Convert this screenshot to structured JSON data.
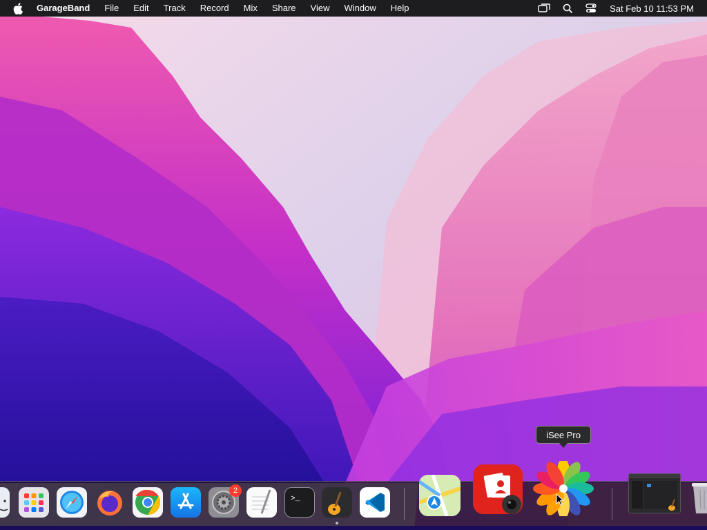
{
  "menubar": {
    "app_name": "GarageBand",
    "items": [
      "File",
      "Edit",
      "Track",
      "Record",
      "Mix",
      "Share",
      "View",
      "Window",
      "Help"
    ],
    "clock": "Sat Feb 10  11:53 PM"
  },
  "tooltip": {
    "text": "iSee Pro"
  },
  "dock": {
    "apps": [
      {
        "name": "Finder",
        "icon": "finder-icon"
      },
      {
        "name": "Launchpad",
        "icon": "launchpad-icon"
      },
      {
        "name": "Safari",
        "icon": "safari-icon"
      },
      {
        "name": "Firefox",
        "icon": "firefox-icon"
      },
      {
        "name": "Google Chrome",
        "icon": "chrome-icon"
      },
      {
        "name": "App Store",
        "icon": "app-store-icon"
      },
      {
        "name": "System Preferences",
        "icon": "system-preferences-icon",
        "badge": "2"
      },
      {
        "name": "TextEdit",
        "icon": "textedit-icon"
      },
      {
        "name": "Terminal",
        "icon": "terminal-icon"
      },
      {
        "name": "GarageBand",
        "icon": "garageband-icon",
        "running": true
      },
      {
        "name": "Visual Studio Code",
        "icon": "vscode-icon"
      },
      {
        "name": "Maps",
        "icon": "maps-icon"
      },
      {
        "name": "Photo Booth",
        "icon": "photo-booth-icon"
      },
      {
        "name": "iSee Pro",
        "icon": "isee-pro-icon"
      },
      {
        "name": "GarageBand window",
        "icon": "minimized-window-icon"
      },
      {
        "name": "Trash",
        "icon": "trash-icon"
      }
    ]
  },
  "colors": {
    "menubar_bg": "#1d1d1f",
    "badge": "#ff3b30",
    "tooltip_bg": "#2b2b2b"
  }
}
